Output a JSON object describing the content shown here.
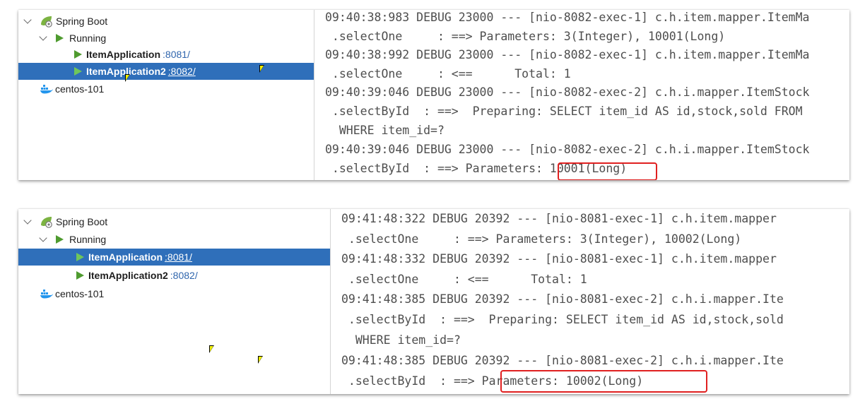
{
  "tree": {
    "spring_boot": "Spring Boot",
    "running": "Running",
    "centos": "centos-101",
    "apps": [
      {
        "name": "ItemApplication",
        "port": ":8081/"
      },
      {
        "name": "ItemApplication2",
        "port": ":8082/"
      }
    ]
  },
  "log_top": [
    "09:40:38:983 DEBUG 23000 --- [nio-8082-exec-1] c.h.item.mapper.ItemMa",
    " .selectOne     : ==> Parameters: 3(Integer), 10001(Long)",
    "09:40:38:992 DEBUG 23000 --- [nio-8082-exec-1] c.h.item.mapper.ItemMa",
    " .selectOne     : <==      Total: 1",
    "09:40:39:046 DEBUG 23000 --- [nio-8082-exec-2] c.h.i.mapper.ItemStock",
    " .selectById  : ==>  Preparing: SELECT item_id AS id,stock,sold FROM",
    "  WHERE item_id=?",
    "09:40:39:046 DEBUG 23000 --- [nio-8082-exec-2] c.h.i.mapper.ItemStock",
    " .selectById  : ==> Parameters: 10001(Long)"
  ],
  "log_bottom": [
    "09:41:48:322 DEBUG 20392 --- [nio-8081-exec-1] c.h.item.mapper",
    " .selectOne     : ==> Parameters: 3(Integer), 10002(Long)",
    "09:41:48:332 DEBUG 20392 --- [nio-8081-exec-1] c.h.item.mapper",
    " .selectOne     : <==      Total: 1",
    "09:41:48:385 DEBUG 20392 --- [nio-8081-exec-2] c.h.i.mapper.Ite",
    " .selectById  : ==>  Preparing: SELECT item_id AS id,stock,sold",
    "  WHERE item_id=?",
    "09:41:48:385 DEBUG 20392 --- [nio-8081-exec-2] c.h.i.mapper.Ite",
    " .selectById  : ==> Parameters: 10002(Long)"
  ],
  "colors": {
    "selection": "#2f6fba",
    "play": "#4f9b2f",
    "port_link": "#2f65ad",
    "highlight_box": "#e02020",
    "log_text": "#4e4e4e"
  },
  "icons": [
    "chevron-down-icon",
    "spring-boot-icon",
    "run-icon",
    "docker-icon",
    "mouse-cursor-icon"
  ]
}
